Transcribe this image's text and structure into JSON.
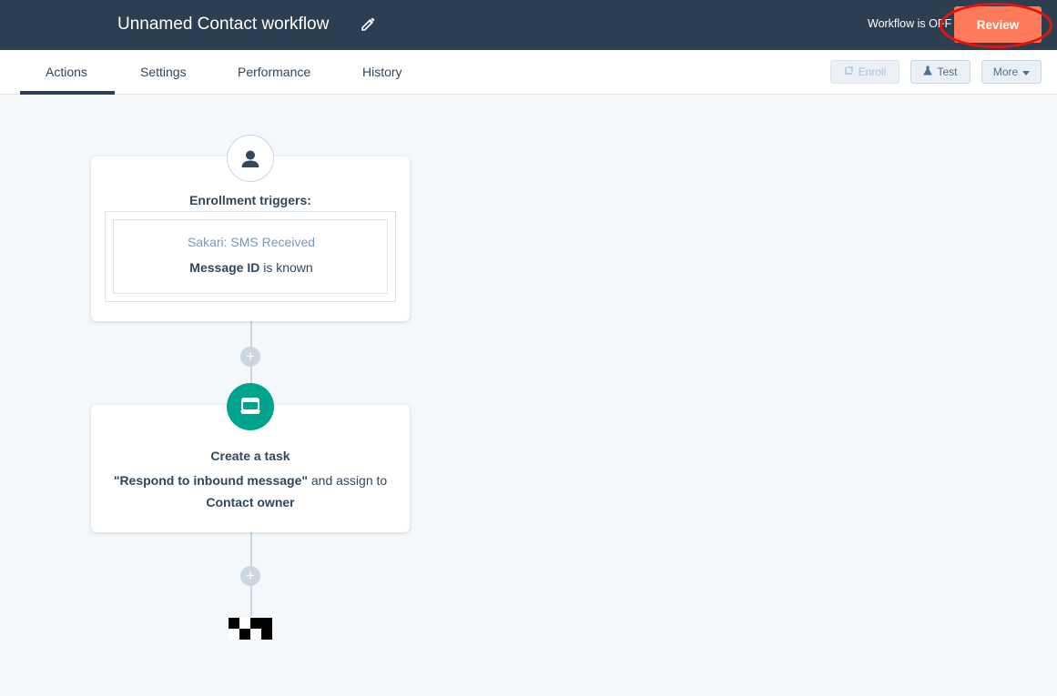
{
  "header": {
    "title": "Unnamed Contact workflow",
    "status": "Workflow is OFF",
    "review_label": "Review"
  },
  "tabs": [
    {
      "label": "Actions",
      "active": true
    },
    {
      "label": "Settings",
      "active": false
    },
    {
      "label": "Performance",
      "active": false
    },
    {
      "label": "History",
      "active": false
    }
  ],
  "toolbar": {
    "enroll_label": "Enroll",
    "test_label": "Test",
    "more_label": "More"
  },
  "trigger_card": {
    "heading": "Enrollment triggers:",
    "source": "Sakari: SMS Received",
    "filter_property": "Message ID",
    "filter_condition": "is known"
  },
  "task_card": {
    "heading": "Create a task",
    "task_name": "\"Respond to inbound message\"",
    "assign_text": "and assign to",
    "assignee": "Contact owner"
  },
  "icons": {
    "edit": "pencil-icon",
    "contact": "contact-icon",
    "task": "task-icon",
    "enroll": "enroll-icon",
    "test": "flask-icon",
    "more": "caret-down-icon",
    "add": "plus-icon",
    "end": "checkered-flag-icon"
  },
  "colors": {
    "header_bg": "#2d3e50",
    "review_button": "#ff7a59",
    "highlight_ring": "#e8120c",
    "task_node": "#00a38d",
    "canvas_bg": "#f5f8fa"
  }
}
